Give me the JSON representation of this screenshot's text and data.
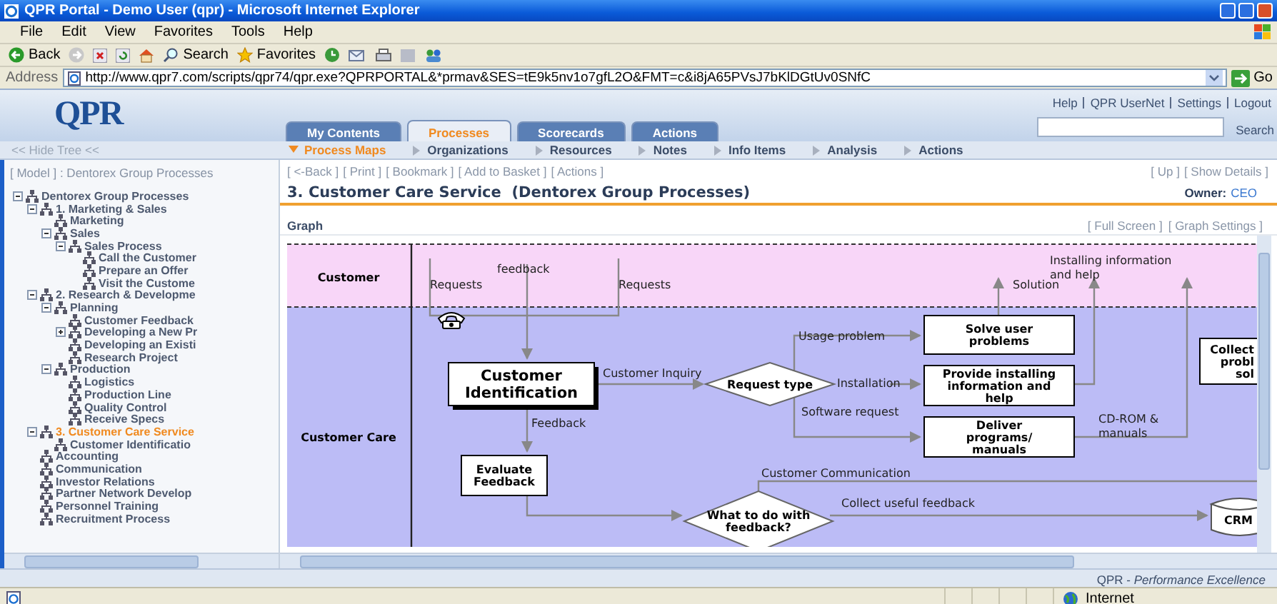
{
  "window": {
    "title": "QPR Portal - Demo User (qpr) - Microsoft Internet Explorer"
  },
  "menu": [
    "File",
    "Edit",
    "View",
    "Favorites",
    "Tools",
    "Help"
  ],
  "toolbar": [
    {
      "kind": "back",
      "label": "Back"
    },
    {
      "kind": "search",
      "label": "Search"
    },
    {
      "kind": "favorites",
      "label": "Favorites"
    }
  ],
  "address": {
    "label": "Address",
    "url": "http://www.qpr7.com/scripts/qpr74/qpr.exe?QPRPORTAL&*prmav&SES=tE9k5nv1o7gfL2O&FMT=c&i8jA65PVsJ7bKlDGtUv0SNfC",
    "go": "Go"
  },
  "portal": {
    "logo": "QPR",
    "links": [
      "Help",
      "QPR UserNet",
      "Settings",
      "Logout"
    ],
    "tabs": [
      {
        "label": "My Contents",
        "selected": false
      },
      {
        "label": "Processes",
        "selected": true
      },
      {
        "label": "Scorecards",
        "selected": false
      },
      {
        "label": "Actions",
        "selected": false
      }
    ],
    "search_button": "Search"
  },
  "subnav": {
    "hide_tree": "<< Hide Tree <<",
    "items": [
      {
        "label": "Process Maps",
        "selected": true
      },
      {
        "label": "Organizations",
        "selected": false
      },
      {
        "label": "Resources",
        "selected": false
      },
      {
        "label": "Notes",
        "selected": false
      },
      {
        "label": "Info Items",
        "selected": false
      },
      {
        "label": "Analysis",
        "selected": false
      },
      {
        "label": "Actions",
        "selected": false
      }
    ]
  },
  "tree": {
    "header": "[ Model ] : Dentorex Group Processes",
    "items": [
      {
        "label": "Dentorex Group Processes",
        "selected": false,
        "expanded": true,
        "children": [
          {
            "label": "1. Marketing & Sales",
            "selected": false,
            "expanded": true,
            "children": [
              {
                "label": "Marketing",
                "selected": false
              },
              {
                "label": "Sales",
                "selected": false,
                "expanded": true,
                "children": [
                  {
                    "label": "Sales Process",
                    "selected": false,
                    "expanded": true,
                    "children": [
                      {
                        "label": "Call the Customer",
                        "selected": false
                      },
                      {
                        "label": "Prepare an Offer",
                        "selected": false
                      },
                      {
                        "label": "Visit the Custome",
                        "selected": false
                      }
                    ]
                  }
                ]
              }
            ]
          },
          {
            "label": "2. Research & Developme",
            "selected": false,
            "expanded": true,
            "children": [
              {
                "label": "Planning",
                "selected": false,
                "expanded": true,
                "children": [
                  {
                    "label": "Customer Feedback",
                    "selected": false
                  },
                  {
                    "label": "Developing a New Pr",
                    "selected": false,
                    "expanded": false
                  },
                  {
                    "label": "Developing an Existi",
                    "selected": false
                  },
                  {
                    "label": "Research Project",
                    "selected": false
                  }
                ]
              },
              {
                "label": "Production",
                "selected": false,
                "expanded": true,
                "children": [
                  {
                    "label": "Logistics",
                    "selected": false
                  },
                  {
                    "label": "Production Line",
                    "selected": false
                  },
                  {
                    "label": "Quality Control",
                    "selected": false
                  },
                  {
                    "label": "Receive Specs",
                    "selected": false
                  }
                ]
              }
            ]
          },
          {
            "label": "3. Customer Care Service",
            "selected": true,
            "expanded": true,
            "children": [
              {
                "label": "Customer Identificatio",
                "selected": false
              }
            ]
          },
          {
            "label": "Accounting",
            "selected": false
          },
          {
            "label": "Communication",
            "selected": false
          },
          {
            "label": "Investor Relations",
            "selected": false
          },
          {
            "label": "Partner Network Develop",
            "selected": false
          },
          {
            "label": "Personnel Training",
            "selected": false
          },
          {
            "label": "Recruitment Process",
            "selected": false
          }
        ]
      }
    ]
  },
  "content": {
    "actions": [
      "[ <-Back ]",
      "[ Print ]",
      "[ Bookmark ]",
      "[ Add to Basket ]",
      "[ Actions ]"
    ],
    "right_actions": [
      "[ Up ]",
      "[ Show Details ]"
    ],
    "title": "3. Customer Care Service  (Dentorex Group Processes)",
    "owner_label": "Owner:",
    "owner": "CEO",
    "section": "Graph",
    "graph_actions": [
      "[ Full Screen ]",
      "[ Graph Settings ]"
    ]
  },
  "diagram": {
    "lanes": [
      {
        "name": "Customer"
      },
      {
        "name": "Customer Care"
      }
    ],
    "nodes": [
      {
        "kind": "main_process",
        "lines": [
          "Customer",
          "Identification"
        ]
      },
      {
        "kind": "decision",
        "lines": [
          "Request type"
        ]
      },
      {
        "kind": "process",
        "lines": [
          "Solve user",
          "problems"
        ]
      },
      {
        "kind": "process",
        "lines": [
          "Provide installing",
          "information and",
          "help"
        ]
      },
      {
        "kind": "process",
        "lines": [
          "Deliver",
          "programs/",
          "manuals"
        ]
      },
      {
        "kind": "process",
        "lines": [
          "Collect",
          "probl",
          "sol"
        ]
      },
      {
        "kind": "process",
        "lines": [
          "Evaluate",
          "Feedback"
        ]
      },
      {
        "kind": "decision",
        "lines": [
          "What to do with",
          "feedback?"
        ]
      },
      {
        "kind": "database",
        "lines": [
          "CRM"
        ]
      }
    ],
    "labels": [
      "feedback",
      "Requests",
      "Requests",
      "Installing information",
      "and help",
      "Solution",
      "Usage problem",
      "Customer Inquiry",
      "Installation",
      "Software request",
      "CD-ROM &",
      "manuals",
      "Feedback",
      "Customer Communication",
      "Collect useful feedback"
    ]
  },
  "footer": "QPR - *Performance Excellence*",
  "status_bar": {
    "zone": "Internet"
  }
}
